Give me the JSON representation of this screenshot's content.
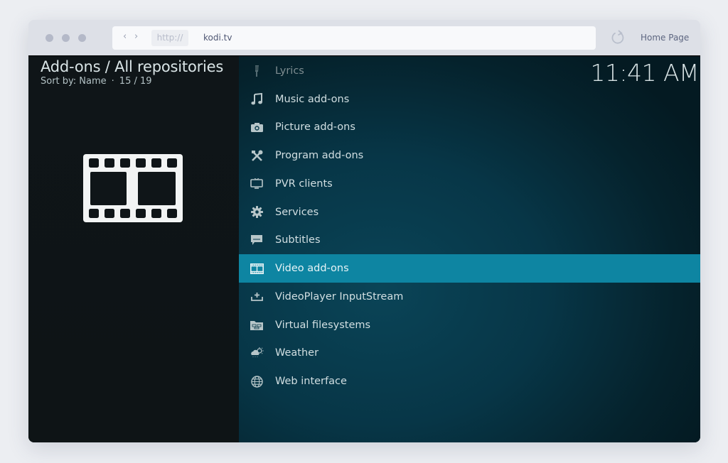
{
  "browser": {
    "nav_back": "‹",
    "nav_forward": "›",
    "protocol": "http://",
    "domain": "kodi.tv",
    "reload_icon": "reload-icon",
    "home_page_label": "Home Page"
  },
  "kodi": {
    "header": {
      "title": "Add-ons / All repositories",
      "sort_label": "Sort by: Name",
      "separator": "·",
      "position": "15 / 19"
    },
    "clock": "11:41 AM",
    "preview_icon": "film-strip-icon",
    "colors": {
      "selected_row": "#0e85a2",
      "left_pane": "#0f1518",
      "right_pane": "#073647"
    },
    "list": [
      {
        "label": "Lyrics",
        "icon": "microphone-icon",
        "state": "dimmed"
      },
      {
        "label": "Music add-ons",
        "icon": "music-note-icon",
        "state": "normal"
      },
      {
        "label": "Picture add-ons",
        "icon": "camera-icon",
        "state": "normal"
      },
      {
        "label": "Program add-ons",
        "icon": "tools-icon",
        "state": "normal"
      },
      {
        "label": "PVR clients",
        "icon": "tv-icon",
        "state": "normal"
      },
      {
        "label": "Services",
        "icon": "gear-icon",
        "state": "normal"
      },
      {
        "label": "Subtitles",
        "icon": "speech-bubble-icon",
        "state": "normal"
      },
      {
        "label": "Video add-ons",
        "icon": "film-icon",
        "state": "selected"
      },
      {
        "label": "VideoPlayer InputStream",
        "icon": "upload-tray-icon",
        "state": "normal"
      },
      {
        "label": "Virtual filesystems",
        "icon": "folder-icon",
        "state": "normal"
      },
      {
        "label": "Weather",
        "icon": "weather-cloud-icon",
        "state": "normal"
      },
      {
        "label": "Web interface",
        "icon": "globe-icon",
        "state": "normal"
      }
    ]
  }
}
